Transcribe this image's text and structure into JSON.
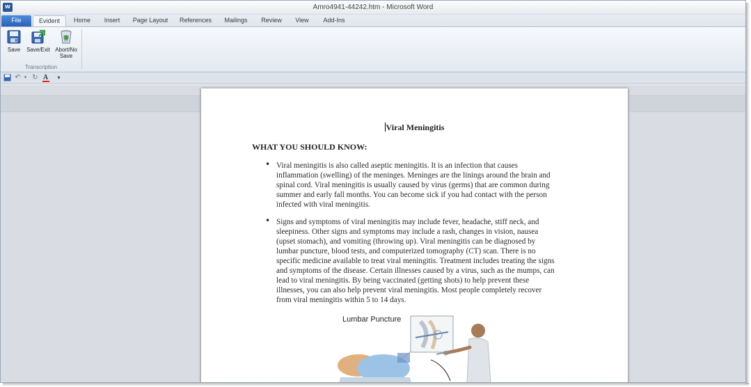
{
  "window": {
    "title": "Amro4941-44242.htm - Microsoft Word",
    "app_icon_label": "W"
  },
  "tabs": [
    {
      "label": "File"
    },
    {
      "label": "Evident"
    },
    {
      "label": "Home"
    },
    {
      "label": "Insert"
    },
    {
      "label": "Page Layout"
    },
    {
      "label": "References"
    },
    {
      "label": "Mailings"
    },
    {
      "label": "Review"
    },
    {
      "label": "View"
    },
    {
      "label": "Add-Ins"
    }
  ],
  "ribbon": {
    "save_label": "Save",
    "save_exit_label": "Save/Exit",
    "abort_label_line1": "Abort/No",
    "abort_label_line2": "Save",
    "group_label": "Transcription"
  },
  "qat": {
    "icons": [
      "save-icon",
      "undo-icon",
      "redo-icon",
      "font-color-icon",
      "customize-icon"
    ]
  },
  "document": {
    "title": "Viral Meningitis",
    "heading": "WHAT YOU SHOULD KNOW:",
    "bullets": [
      {
        "lines": [
          "Viral meningitis is also called aseptic meningitis. It is an infection that causes",
          "inflammation (swelling) of the meninges. Meninges are the linings around the brain and",
          "spinal cord. Viral meningitis is usually caused by virus (germs) that are common during",
          "summer and early fall months. You can become sick if you had contact with the person",
          "infected with viral meningitis."
        ]
      },
      {
        "lines": [
          "Signs and symptoms of viral meningitis may include fever, headache, stiff neck, and",
          "sleepiness. Other signs and symptoms may include a rash, changes in vision, nausea",
          "(upset stomach), and vomiting (throwing up). Viral meningitis can be diagnosed by",
          "lumbar puncture, blood tests, and computerized tomography (CT) scan. There is no",
          "specific medicine available to treat viral meningitis. Treatment includes treating the signs",
          "and symptoms of the disease. Certain illnesses caused by a virus, such as the mumps, can",
          "lead to viral meningitis. By being vaccinated (getting shots) to help prevent these",
          "illnesses, you can also help prevent viral meningitis. Most people completely recover",
          "from viral meningitis within 5 to 14 days."
        ]
      }
    ],
    "figure_label": "Lumbar Puncture"
  }
}
